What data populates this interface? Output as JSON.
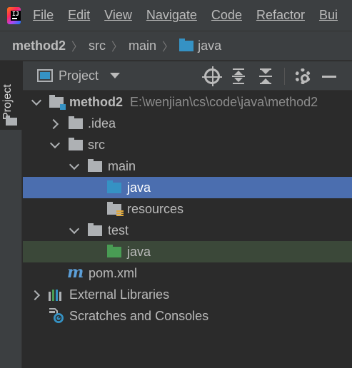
{
  "menu": {
    "items": [
      {
        "label": "File"
      },
      {
        "label": "Edit"
      },
      {
        "label": "View"
      },
      {
        "label": "Navigate"
      },
      {
        "label": "Code"
      },
      {
        "label": "Refactor"
      },
      {
        "label": "Bui"
      }
    ]
  },
  "breadcrumb": {
    "items": [
      "method2",
      "src",
      "main",
      "java"
    ]
  },
  "left_strip": {
    "project_tab": "Project"
  },
  "panel": {
    "view_label": "Project",
    "icons": [
      "locate-icon",
      "expand-all-icon",
      "collapse-all-icon",
      "gear-icon",
      "minimize-icon"
    ]
  },
  "tree": {
    "root": {
      "name": "method2",
      "path": "E:\\wenjian\\cs\\code\\java\\method2"
    },
    "idea": "idea",
    "src": "src",
    "main": "main",
    "main_java": "java",
    "resources": "resources",
    "test": "test",
    "test_java": "java",
    "pom": "pom.xml",
    "external_libraries": "External Libraries",
    "scratches": "Scratches and Consoles"
  },
  "colors": {
    "selection": "#4b6eaf",
    "test_row": "#3b4839",
    "source_folder": "#3592c4",
    "test_folder": "#499c54"
  }
}
